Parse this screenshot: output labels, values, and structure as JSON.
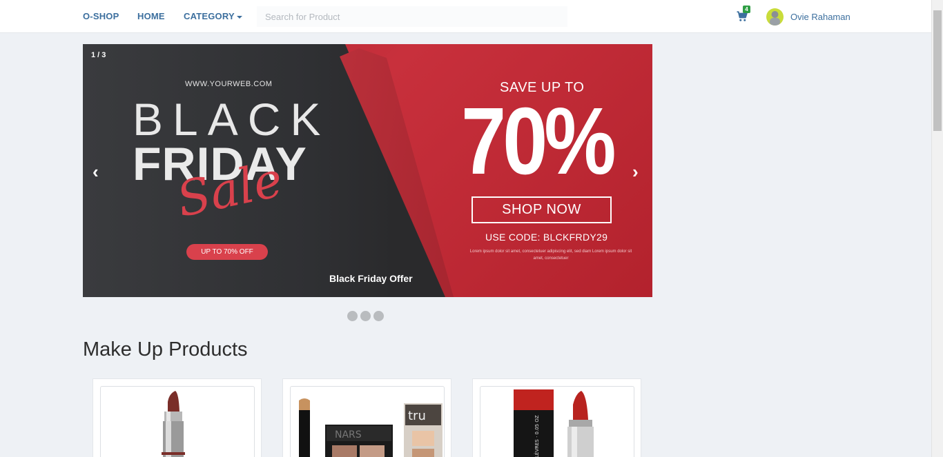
{
  "nav": {
    "brand": "O-SHOP",
    "home": "HOME",
    "category": "CATEGORY",
    "search_placeholder": "Search for Product",
    "cart_count": "4",
    "user_name": "Ovie Rahaman"
  },
  "carousel": {
    "counter": "1 / 3",
    "prev_arrow": "‹",
    "next_arrow": "›",
    "web_url": "WWW.YOURWEB.COM",
    "headline_black": "BLACK",
    "headline_friday": "FRIDAY",
    "headline_sale": "Sale",
    "off_pill": "UP TO 70% OFF",
    "caption": "Black Friday Offer",
    "save_up_to": "SAVE UP TO",
    "percent": "70%",
    "shop_now": "SHOP NOW",
    "use_code": "USE CODE: BLCKFRDY29",
    "lorem": "Lorem ipsum dolor sit amet, consectetuer adipiscing elit, sed diam Lorem ipsum dolor sit amet, consectetuer",
    "dot_count": 3
  },
  "section": {
    "title": "Make Up Products"
  },
  "products": [
    {
      "image": "lipstick-brown"
    },
    {
      "image": "makeup-palette-set"
    },
    {
      "image": "lipstick-red-box"
    }
  ],
  "colors": {
    "accent": "#3c6f9e",
    "badge": "#2f9e44",
    "sale_red": "#d9414c"
  }
}
